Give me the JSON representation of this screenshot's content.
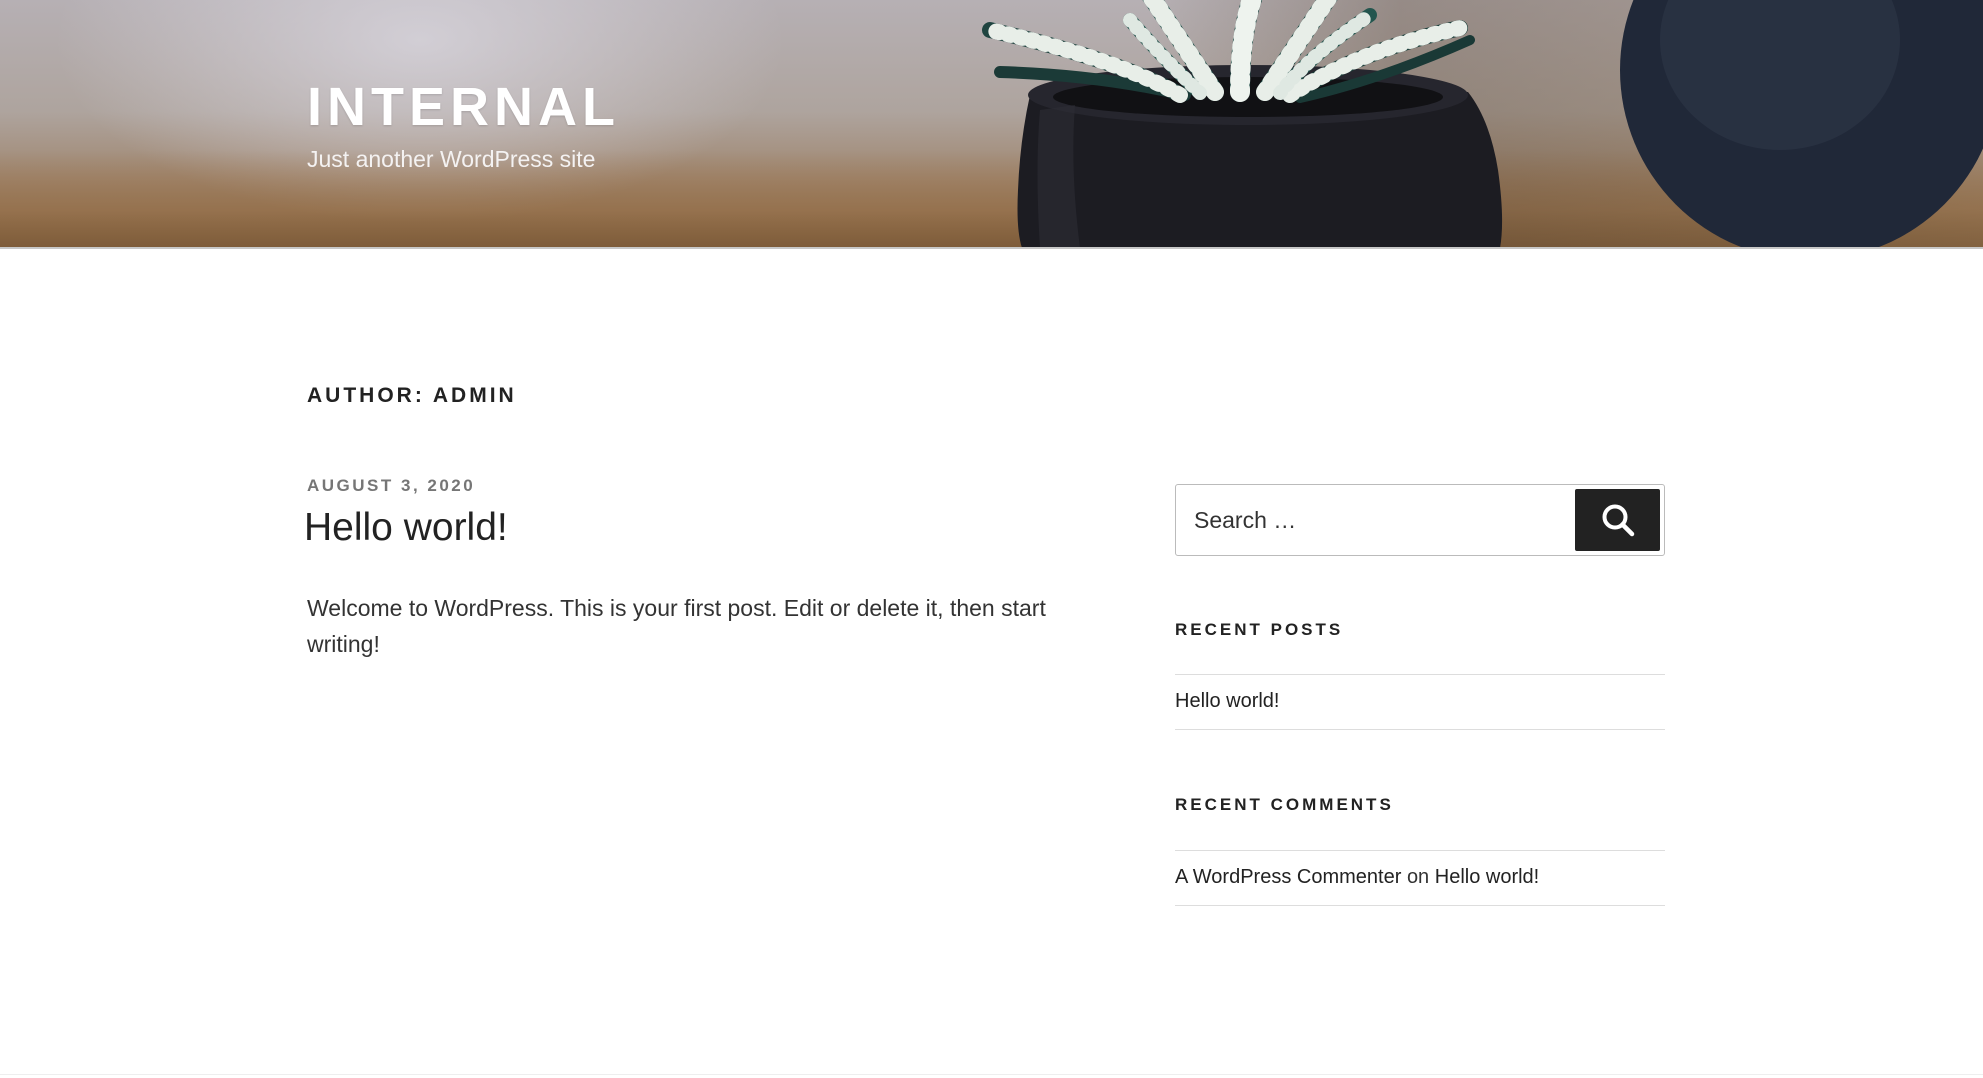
{
  "header": {
    "site_title": "INTERNAL",
    "tagline": "Just another WordPress site"
  },
  "main": {
    "page_title": "AUTHOR: ADMIN",
    "posts": [
      {
        "date": "AUGUST 3, 2020",
        "title": "Hello world!",
        "excerpt": "Welcome to WordPress. This is your first post. Edit or delete it, then start writing!"
      }
    ]
  },
  "sidebar": {
    "search": {
      "placeholder": "Search …",
      "button_icon": "search-icon"
    },
    "recent_posts": {
      "title": "RECENT POSTS",
      "items": [
        "Hello world!"
      ]
    },
    "recent_comments": {
      "title": "RECENT COMMENTS",
      "items": [
        {
          "author": "A WordPress Commenter",
          "connector": "on",
          "post": "Hello world!"
        }
      ]
    }
  },
  "colors": {
    "text_dark": "#222222",
    "text_body": "#333333",
    "text_muted": "#767676",
    "button_bg": "#222222",
    "rule": "#dddddd"
  }
}
